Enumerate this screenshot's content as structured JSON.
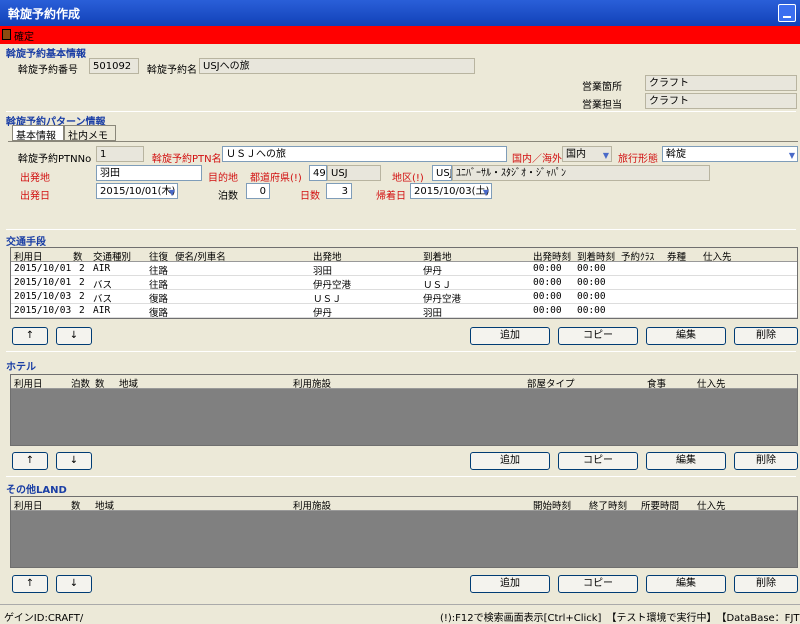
{
  "window": {
    "title": "斡旋予約作成"
  },
  "toolbar": {
    "confirm_label": "確定"
  },
  "basic": {
    "section": "斡旋予約基本情報",
    "no_label": "斡旋予約番号",
    "no_value": "501092",
    "name_label": "斡旋予約名",
    "name_value": "USJへの旅",
    "office_label": "営業箇所",
    "office_value": "クラフト",
    "staff_label": "営業担当",
    "staff_value": "クラフト"
  },
  "pattern": {
    "section": "斡旋予約パターン情報",
    "tab_basic": "基本情報",
    "tab_memo": "社内メモ",
    "ptnno_label": "斡旋予約PTNNo",
    "ptnno_value": "1",
    "ptnname_label": "斡旋予約PTN名",
    "ptnname_value": "ＵＳＪへの旅",
    "domestic_label": "国内／海外",
    "domestic_value": "国内",
    "form_label": "旅行形態",
    "form_value": "斡旋",
    "dep_label": "出発地",
    "dep_value": "羽田",
    "dest_label": "目的地",
    "pref_label": "都道府県(!)",
    "pref_code": "49",
    "pref_name": "USJ",
    "area_label": "地区(!)",
    "area_code": "USJ",
    "area_name": "ﾕﾆﾊﾞｰｻﾙ・ｽﾀｼﾞｵ・ｼﾞｬﾊﾟﾝ",
    "depdate_label": "出発日",
    "depdate_value": "2015/10/01(木)",
    "nights_label": "泊数",
    "nights_value": "0",
    "days_label": "日数",
    "days_value": "3",
    "retdate_label": "帰着日",
    "retdate_value": "2015/10/03(土)"
  },
  "transport": {
    "section": "交通手段",
    "headers": [
      "利用日",
      "数",
      "交通種別",
      "往復",
      "便名/列車名",
      "出発地",
      "到着地",
      "出発時刻",
      "到着時刻",
      "予約ｸﾗｽ",
      "券種",
      "仕入先"
    ],
    "rows": [
      [
        "2015/10/01",
        "2",
        "AIR",
        "往路",
        "",
        "羽田",
        "伊丹",
        "00:00",
        "00:00"
      ],
      [
        "2015/10/01",
        "2",
        "バス",
        "往路",
        "",
        "伊丹空港",
        "ＵＳＪ",
        "00:00",
        "00:00"
      ],
      [
        "2015/10/03",
        "2",
        "バス",
        "復路",
        "",
        "ＵＳＪ",
        "伊丹空港",
        "00:00",
        "00:00"
      ],
      [
        "2015/10/03",
        "2",
        "AIR",
        "復路",
        "",
        "伊丹",
        "羽田",
        "00:00",
        "00:00"
      ]
    ]
  },
  "hotel": {
    "section": "ホテル",
    "headers": [
      "利用日",
      "泊数",
      "数",
      "地域",
      "利用施設",
      "部屋タイプ",
      "食事",
      "仕入先"
    ]
  },
  "land": {
    "section": "その他LAND",
    "headers": [
      "利用日",
      "数",
      "地域",
      "利用施設",
      "開始時刻",
      "終了時刻",
      "所要時間",
      "仕入先"
    ]
  },
  "buttons": {
    "up": "↑",
    "down": "↓",
    "add": "追加",
    "copy": "コピー",
    "edit": "編集",
    "delete": "削除"
  },
  "status": {
    "login": "ゲインID:CRAFT/",
    "hint": "(!):F12で検索画面表示[Ctrl+Click]　【テスト環境で実行中】　【DataBase：FJT"
  },
  "colors": {
    "titlebar": "#1141b8",
    "toolbar": "#ff0000",
    "section": "#1a3ea5",
    "required": "#d21010",
    "grid_empty": "#808080"
  }
}
